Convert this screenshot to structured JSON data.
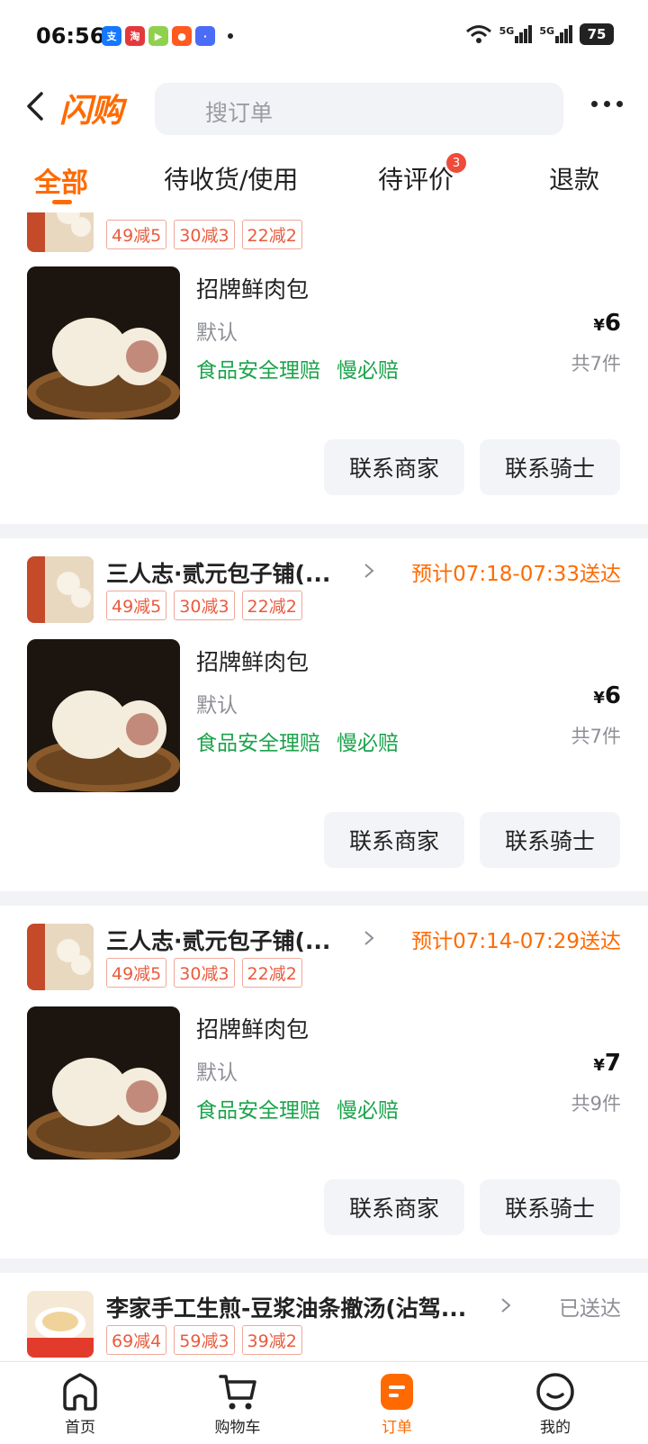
{
  "status_bar": {
    "time": "06:56",
    "network_1": "5G",
    "network_2": "5G",
    "battery": "75",
    "apps": [
      {
        "icon": "alipay-app-icon",
        "label": "支",
        "color": "#1677ff"
      },
      {
        "icon": "app-icon-2",
        "label": "淘",
        "color": "#e4393c"
      },
      {
        "icon": "video-app-icon",
        "label": "▶",
        "color": "#8fd14f"
      },
      {
        "icon": "app-icon-4",
        "label": "●",
        "color": "#ff5a1f"
      },
      {
        "icon": "app-icon-5",
        "label": "·",
        "color": "#4a6cf7"
      }
    ]
  },
  "header": {
    "logo": "闪购",
    "search_placeholder": "搜订单"
  },
  "tabs": [
    {
      "label": "全部",
      "active": true
    },
    {
      "label": "待收货/使用",
      "active": false
    },
    {
      "label": "待评价",
      "active": false,
      "badge": "3"
    },
    {
      "label": "退款",
      "active": false
    }
  ],
  "orders": [
    {
      "store_name": "",
      "eta": "",
      "promos": [
        "49减5",
        "30减3",
        "22减2"
      ],
      "product_name": "招牌鲜肉包",
      "spec": "默认",
      "tags": [
        "食品安全理赔",
        "慢必赔"
      ],
      "currency": "¥",
      "price": "6",
      "qty": "共7件",
      "buttons": [
        "联系商家",
        "联系骑士"
      ]
    },
    {
      "store_name": "三人志·贰元包子铺(...",
      "eta": "预计07:18-07:33送达",
      "promos": [
        "49减5",
        "30减3",
        "22减2"
      ],
      "product_name": "招牌鲜肉包",
      "spec": "默认",
      "tags": [
        "食品安全理赔",
        "慢必赔"
      ],
      "currency": "¥",
      "price": "6",
      "qty": "共7件",
      "buttons": [
        "联系商家",
        "联系骑士"
      ]
    },
    {
      "store_name": "三人志·贰元包子铺(...",
      "eta": "预计07:14-07:29送达",
      "promos": [
        "49减5",
        "30减3",
        "22减2"
      ],
      "product_name": "招牌鲜肉包",
      "spec": "默认",
      "tags": [
        "食品安全理赔",
        "慢必赔"
      ],
      "currency": "¥",
      "price": "7",
      "qty": "共9件",
      "buttons": [
        "联系商家",
        "联系骑士"
      ]
    },
    {
      "store_name": "李家手工生煎-豆浆油条撤汤(沾驾...",
      "eta": "已送达",
      "promos": [
        "69减4",
        "59减3",
        "39减2"
      ]
    }
  ],
  "bottom_nav": [
    {
      "label": "首页",
      "icon": "home-icon"
    },
    {
      "label": "购物车",
      "icon": "cart-icon"
    },
    {
      "label": "订单",
      "icon": "orders-icon",
      "active": true
    },
    {
      "label": "我的",
      "icon": "profile-icon"
    }
  ],
  "colors": {
    "accent": "#ff6a00",
    "promo_red": "#ea5a3d",
    "green_tag": "#1aa34a",
    "badge_red": "#ee4b3b"
  }
}
